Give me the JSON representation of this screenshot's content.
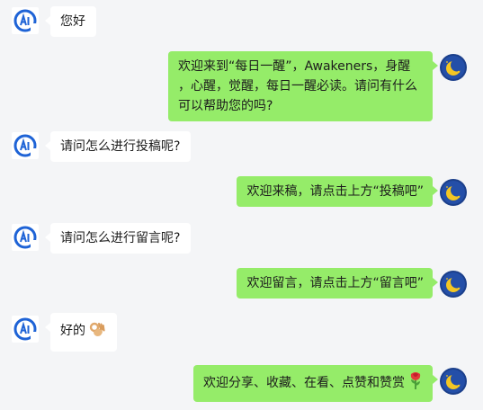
{
  "colors": {
    "background": "#f4f5f7",
    "user_bubble": "#ffffff",
    "bot_bubble": "#95ec69",
    "user_avatar_accent": "#1e63d6",
    "bot_avatar_bg": "#1b3f8b",
    "bot_avatar_moon": "#f3c623"
  },
  "messages": [
    {
      "sender": "user",
      "text": "您好"
    },
    {
      "sender": "bot",
      "lines": [
        "欢迎来到“每日一醒”，Awakeners，身醒",
        "，心醒，觉醒，每日一醒必读。请问有什么",
        "可以帮助您的吗?"
      ]
    },
    {
      "sender": "user",
      "text": "请问怎么进行投稿呢?"
    },
    {
      "sender": "bot",
      "text": "欢迎来稿，请点击上方“投稿吧”"
    },
    {
      "sender": "user",
      "text": "请问怎么进行留言呢?"
    },
    {
      "sender": "bot",
      "text": "欢迎留言，请点击上方“留言吧”"
    },
    {
      "sender": "user",
      "text": "好的",
      "emoji": "ok-hand"
    },
    {
      "sender": "bot",
      "text": "欢迎分享、收藏、在看、点赞和赞赏",
      "emoji": "rose"
    }
  ],
  "avatars": {
    "user_icon": "ai-logo-icon",
    "bot_icon": "crescent-moon-icon"
  }
}
